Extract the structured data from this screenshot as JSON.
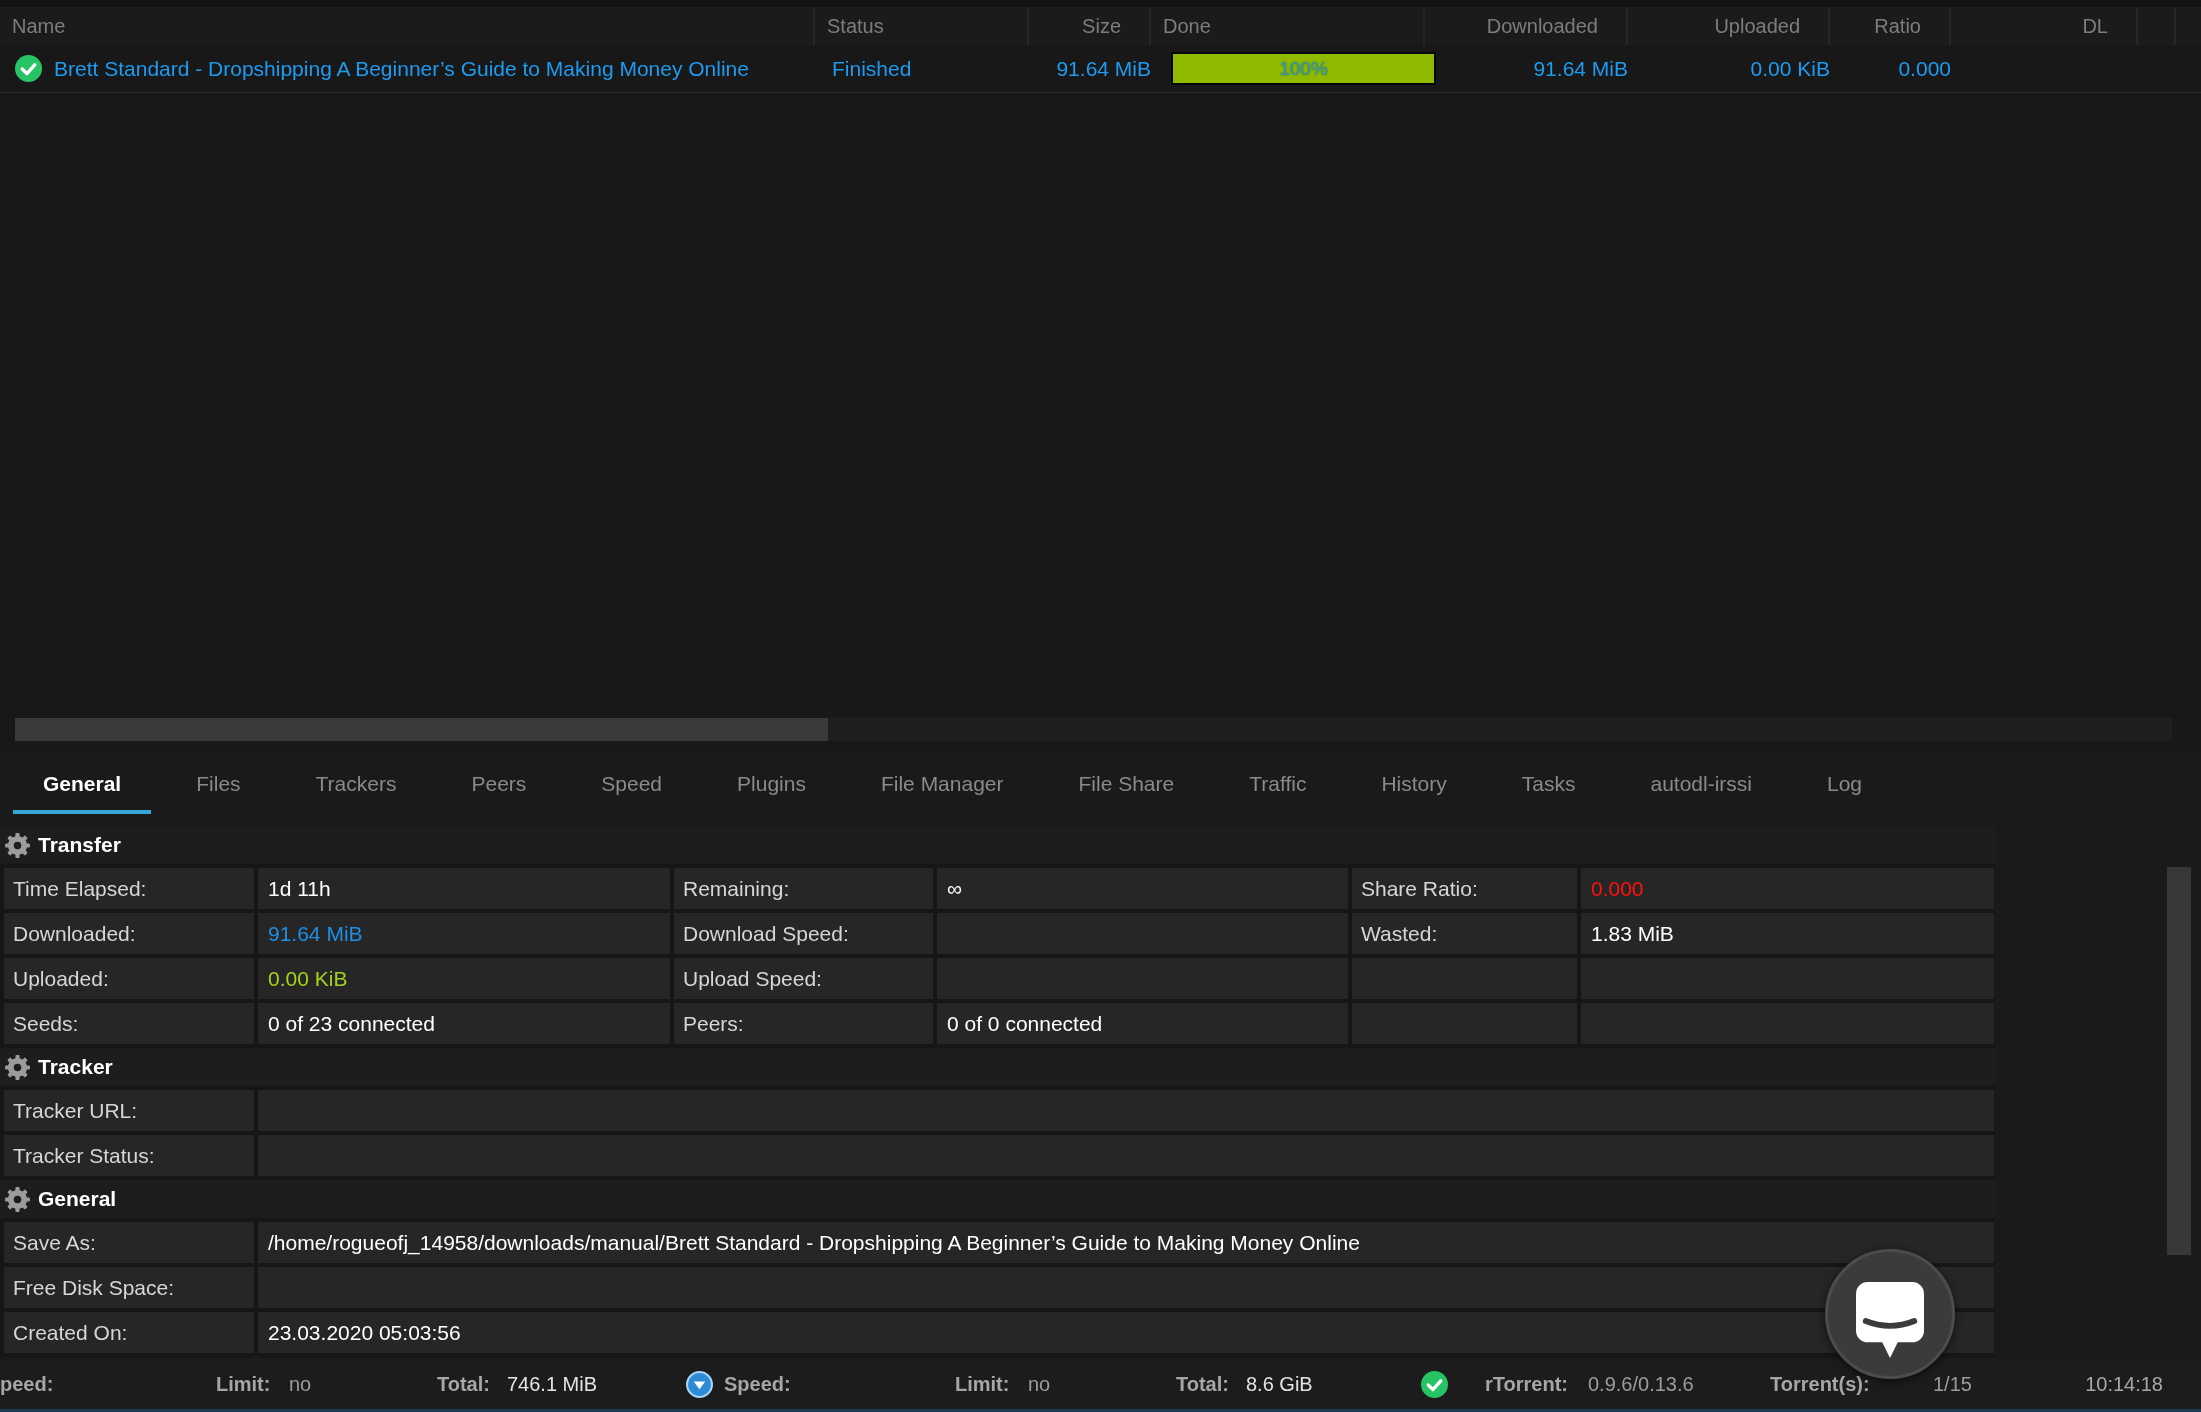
{
  "torrent_list": {
    "columns": [
      "Name",
      "Status",
      "Size",
      "Done",
      "Downloaded",
      "Uploaded",
      "Ratio",
      "DL"
    ],
    "rows": [
      {
        "name": "Brett Standard - Dropshipping A Beginner’s Guide to Making Money Online",
        "status": "Finished",
        "size": "91.64 MiB",
        "done": {
          "level": 1,
          "label": "100%"
        },
        "downloaded": "91.64 MiB",
        "uploaded": "0.00 KiB",
        "ratio": "0.000"
      }
    ]
  },
  "tabs": [
    {
      "label": "General",
      "selected": true
    },
    {
      "label": "Files",
      "selected": false
    },
    {
      "label": "Trackers",
      "selected": false
    },
    {
      "label": "Peers",
      "selected": false
    },
    {
      "label": "Speed",
      "selected": false
    },
    {
      "label": "Plugins",
      "selected": false
    },
    {
      "label": "File Manager",
      "selected": false
    },
    {
      "label": "File Share",
      "selected": false
    },
    {
      "label": "Traffic",
      "selected": false
    },
    {
      "label": "History",
      "selected": false
    },
    {
      "label": "Tasks",
      "selected": false
    },
    {
      "label": "autodl-irssi",
      "selected": false
    },
    {
      "label": "Log",
      "selected": false
    }
  ],
  "details": {
    "sections": [
      {
        "title": "Transfer",
        "rows": [
          [
            {
              "label": "Time Elapsed:",
              "value": "1d 11h"
            },
            {
              "label": "Remaining:",
              "value": "∞"
            },
            {
              "label": "Share Ratio:",
              "value": "0.000",
              "color": "#ff1010"
            }
          ],
          [
            {
              "label": "Downloaded:",
              "value": "91.64 MiB",
              "color": "#1e8fe6"
            },
            {
              "label": "Download Speed:"
            },
            {
              "label": "Wasted:",
              "value": "1.83 MiB"
            }
          ],
          [
            {
              "label": "Uploaded:",
              "value": "0.00 KiB",
              "color": "#a4d21c"
            },
            {
              "label": "Upload Speed:"
            }
          ],
          [
            {
              "label": "Seeds:",
              "value": "0 of 23 connected"
            },
            {
              "label": "Peers:",
              "value": "0 of 0 connected"
            }
          ]
        ]
      },
      {
        "title": "Tracker",
        "rows": [
          [
            {
              "label": "Tracker URL:"
            }
          ],
          [
            {
              "label": "Tracker Status:"
            }
          ]
        ]
      },
      {
        "title": "General",
        "rows": [
          [
            {
              "label": "Save As:",
              "value": "/home/rogueofj_14958/downloads/manual/Brett Standard - Dropshipping A Beginner’s Guide to Making Money Online"
            }
          ],
          [
            {
              "label": "Free Disk Space:"
            }
          ],
          [
            {
              "label": "Created On:",
              "value": "23.03.2020 05:03:56"
            }
          ]
        ]
      }
    ]
  },
  "status_bar": {
    "groups": [
      {
        "speed_label": "peed:",
        "limit_label": "Limit:",
        "limit": "no",
        "total_label": "Total:",
        "total": "746.1 MiB"
      },
      {
        "speed_label": "Speed:",
        "limit_label": "Limit:",
        "limit": "no",
        "total_label": "Total:",
        "total": "8.6 GiB"
      }
    ],
    "client_label": "rTorrent:",
    "client_version": "0.9.6/0.13.6",
    "torrents_label": "Torrent(s):",
    "torrents": "1/15",
    "time": "10:14:18"
  }
}
